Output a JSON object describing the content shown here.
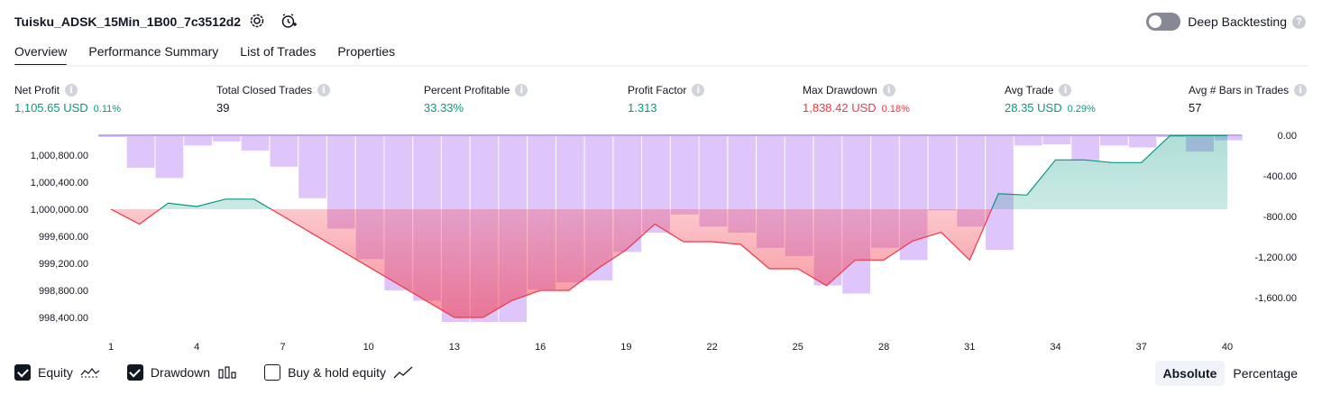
{
  "header": {
    "strategy_name": "Tuisku_ADSK_15Min_1B00_7c3512d2",
    "icons": [
      "settings-icon",
      "alert-add-icon"
    ],
    "deep_backtesting_label": "Deep Backtesting",
    "deep_backtesting_on": false
  },
  "tabs": [
    {
      "label": "Overview",
      "active": true
    },
    {
      "label": "Performance Summary",
      "active": false
    },
    {
      "label": "List of Trades",
      "active": false
    },
    {
      "label": "Properties",
      "active": false
    }
  ],
  "metrics": {
    "net_profit": {
      "label": "Net Profit",
      "value": "1,105.65 USD",
      "sub": "0.11%"
    },
    "total_closed_trades": {
      "label": "Total Closed Trades",
      "value": "39"
    },
    "percent_profitable": {
      "label": "Percent Profitable",
      "value": "33.33%"
    },
    "profit_factor": {
      "label": "Profit Factor",
      "value": "1.313"
    },
    "max_drawdown": {
      "label": "Max Drawdown",
      "value": "1,838.42 USD",
      "sub": "0.18%"
    },
    "avg_trade": {
      "label": "Avg Trade",
      "value": "28.35 USD",
      "sub": "0.29%"
    },
    "avg_bars": {
      "label": "Avg # Bars in Trades",
      "value": "57"
    }
  },
  "colors": {
    "positive": "#089981",
    "negative": "#f23645",
    "drawdown_bar": "#d9bcf9",
    "drawdown_bar_edge": "#c8a2f2",
    "equity_up_fill": "#b2dfd2",
    "equity_down_fill": "#f5b3c0"
  },
  "chart_data": {
    "type": "line",
    "x": [
      1,
      2,
      3,
      4,
      5,
      6,
      7,
      8,
      9,
      10,
      11,
      12,
      13,
      14,
      15,
      16,
      17,
      18,
      19,
      20,
      21,
      22,
      23,
      24,
      25,
      26,
      27,
      28,
      29,
      30,
      31,
      32,
      33,
      34,
      35,
      36,
      37,
      38,
      39,
      40
    ],
    "x_ticks": [
      "1",
      "4",
      "7",
      "10",
      "13",
      "16",
      "19",
      "22",
      "25",
      "28",
      "31",
      "34",
      "37",
      "40"
    ],
    "left_axis": {
      "ticks": [
        "1,000,800.00",
        "1,000,400.00",
        "1,000,000.00",
        "999,600.00",
        "999,200.00",
        "998,800.00",
        "998,400.00"
      ],
      "tick_values": [
        1000800,
        1000400,
        1000000,
        999600,
        999200,
        998800,
        998400
      ]
    },
    "right_axis": {
      "ticks": [
        "0.00",
        "-400.00",
        "-800.00",
        "-1,200.00",
        "-1,600.00"
      ],
      "tick_values": [
        0,
        -400,
        -800,
        -1200,
        -1600
      ]
    },
    "baseline_equity": 1000000,
    "series": [
      {
        "name": "Equity",
        "axis": "left",
        "values": [
          1000000,
          999780,
          1000090,
          1000040,
          1000150,
          1000150,
          999900,
          999650,
          999400,
          999150,
          998900,
          998650,
          998400,
          998400,
          998650,
          998800,
          998800,
          999120,
          999400,
          999780,
          999520,
          999520,
          999480,
          999120,
          999120,
          998870,
          999250,
          999250,
          999530,
          999660,
          999250,
          1000230,
          1000210,
          1000730,
          1000730,
          1000690,
          1000690,
          1001090,
          1001090,
          1001090
        ]
      },
      {
        "name": "Drawdown",
        "axis": "right",
        "type": "bar",
        "values": [
          -10,
          -320,
          -420,
          -100,
          -60,
          -150,
          -310,
          -620,
          -920,
          -1220,
          -1530,
          -1630,
          -1840,
          -1840,
          -1840,
          -1520,
          -1450,
          -1430,
          -1150,
          -960,
          -780,
          -900,
          -960,
          -1110,
          -1190,
          -1480,
          -1560,
          -1110,
          -1230,
          -740,
          -900,
          -1130,
          -100,
          -90,
          -250,
          -100,
          -120,
          -10,
          -160,
          -50
        ]
      }
    ],
    "legend": [
      {
        "label": "Equity",
        "checked": true,
        "icon": "equity-line-icon"
      },
      {
        "label": "Drawdown",
        "checked": true,
        "icon": "drawdown-bars-icon"
      },
      {
        "label": "Buy & hold equity",
        "checked": false,
        "icon": "buy-hold-line-icon"
      }
    ],
    "modes": [
      {
        "label": "Absolute",
        "active": true
      },
      {
        "label": "Percentage",
        "active": false
      }
    ]
  }
}
